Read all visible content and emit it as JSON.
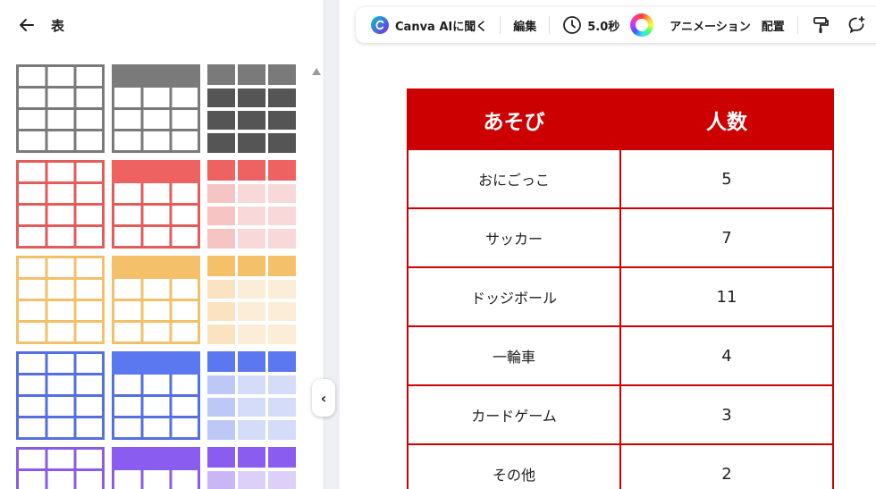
{
  "panel": {
    "title": "表",
    "collapse_glyph": "‹"
  },
  "thumbnails": {
    "rows": [
      {
        "name": "gray",
        "border": "#7a7a7a",
        "header": "#7a7a7a",
        "dark": "#555555",
        "light": "#555555"
      },
      {
        "name": "red",
        "border": "#e35b5b",
        "header": "#ee6262",
        "dark": "#ee6262",
        "light": "#f7c4c4",
        "lighter": "#f8d8d8"
      },
      {
        "name": "yellow",
        "border": "#f3c06a",
        "header": "#f5c06a",
        "dark": "#f5c06a",
        "light": "#fbe3c2",
        "lighter": "#fcedd9"
      },
      {
        "name": "blue",
        "border": "#5470e0",
        "header": "#5b78f0",
        "dark": "#5b78f0",
        "light": "#bdc8f7",
        "lighter": "#d5dcfa"
      },
      {
        "name": "purple",
        "border": "#8a5ce6",
        "header": "#8a5cf0",
        "dark": "#8a5cf0",
        "light": "#c9b6f5",
        "lighter": "#dcd0f8"
      }
    ]
  },
  "toolbar": {
    "canva_ai": "Canva AIに聞く",
    "edit": "編集",
    "duration": "5.0秒",
    "animation": "アニメーション",
    "arrange": "配置"
  },
  "table": {
    "accent": "#cc0000",
    "headers": [
      "あそび",
      "人数"
    ],
    "rows": [
      [
        "おにごっこ",
        "5"
      ],
      [
        "サッカー",
        "7"
      ],
      [
        "ドッジボール",
        "11"
      ],
      [
        "一輪車",
        "4"
      ],
      [
        "カードゲーム",
        "3"
      ],
      [
        "その他",
        "2"
      ]
    ]
  }
}
